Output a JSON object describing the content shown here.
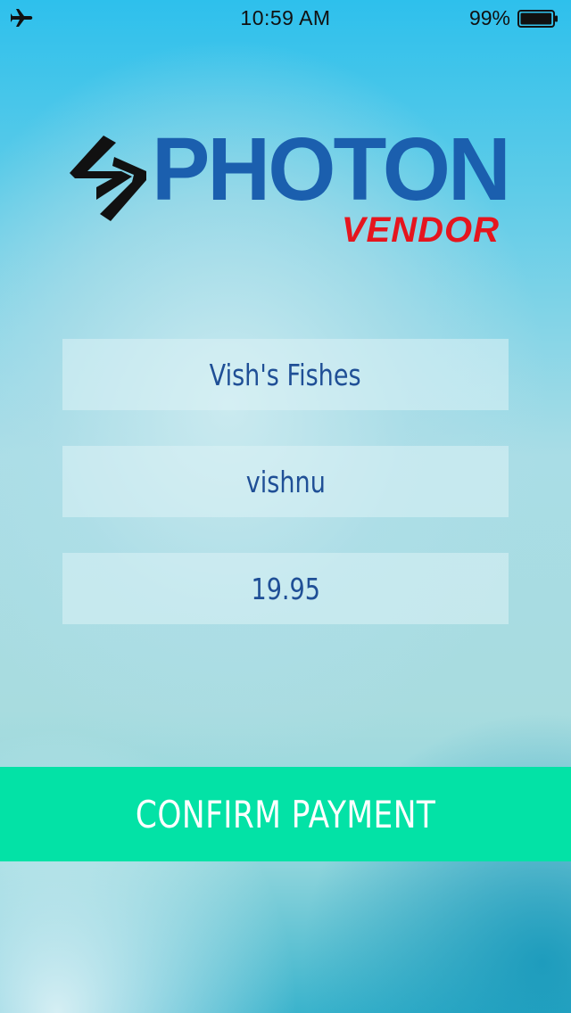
{
  "status_bar": {
    "airplane_icon": "airplane-icon",
    "time": "10:59 AM",
    "battery_percent": "99%",
    "battery_icon": "battery-icon",
    "battery_level": 0.99
  },
  "logo": {
    "wordmark": "PHOTON",
    "subtitle": "VENDOR",
    "colors": {
      "wordmark": "#1b5fae",
      "subtitle": "#e5151e",
      "mark": "#111111"
    }
  },
  "form": {
    "store_name": "Vish's Fishes",
    "username": "vishnu",
    "amount": "19.95"
  },
  "actions": {
    "confirm_label": "CONFIRM PAYMENT",
    "confirm_color": "#03e2a6"
  }
}
